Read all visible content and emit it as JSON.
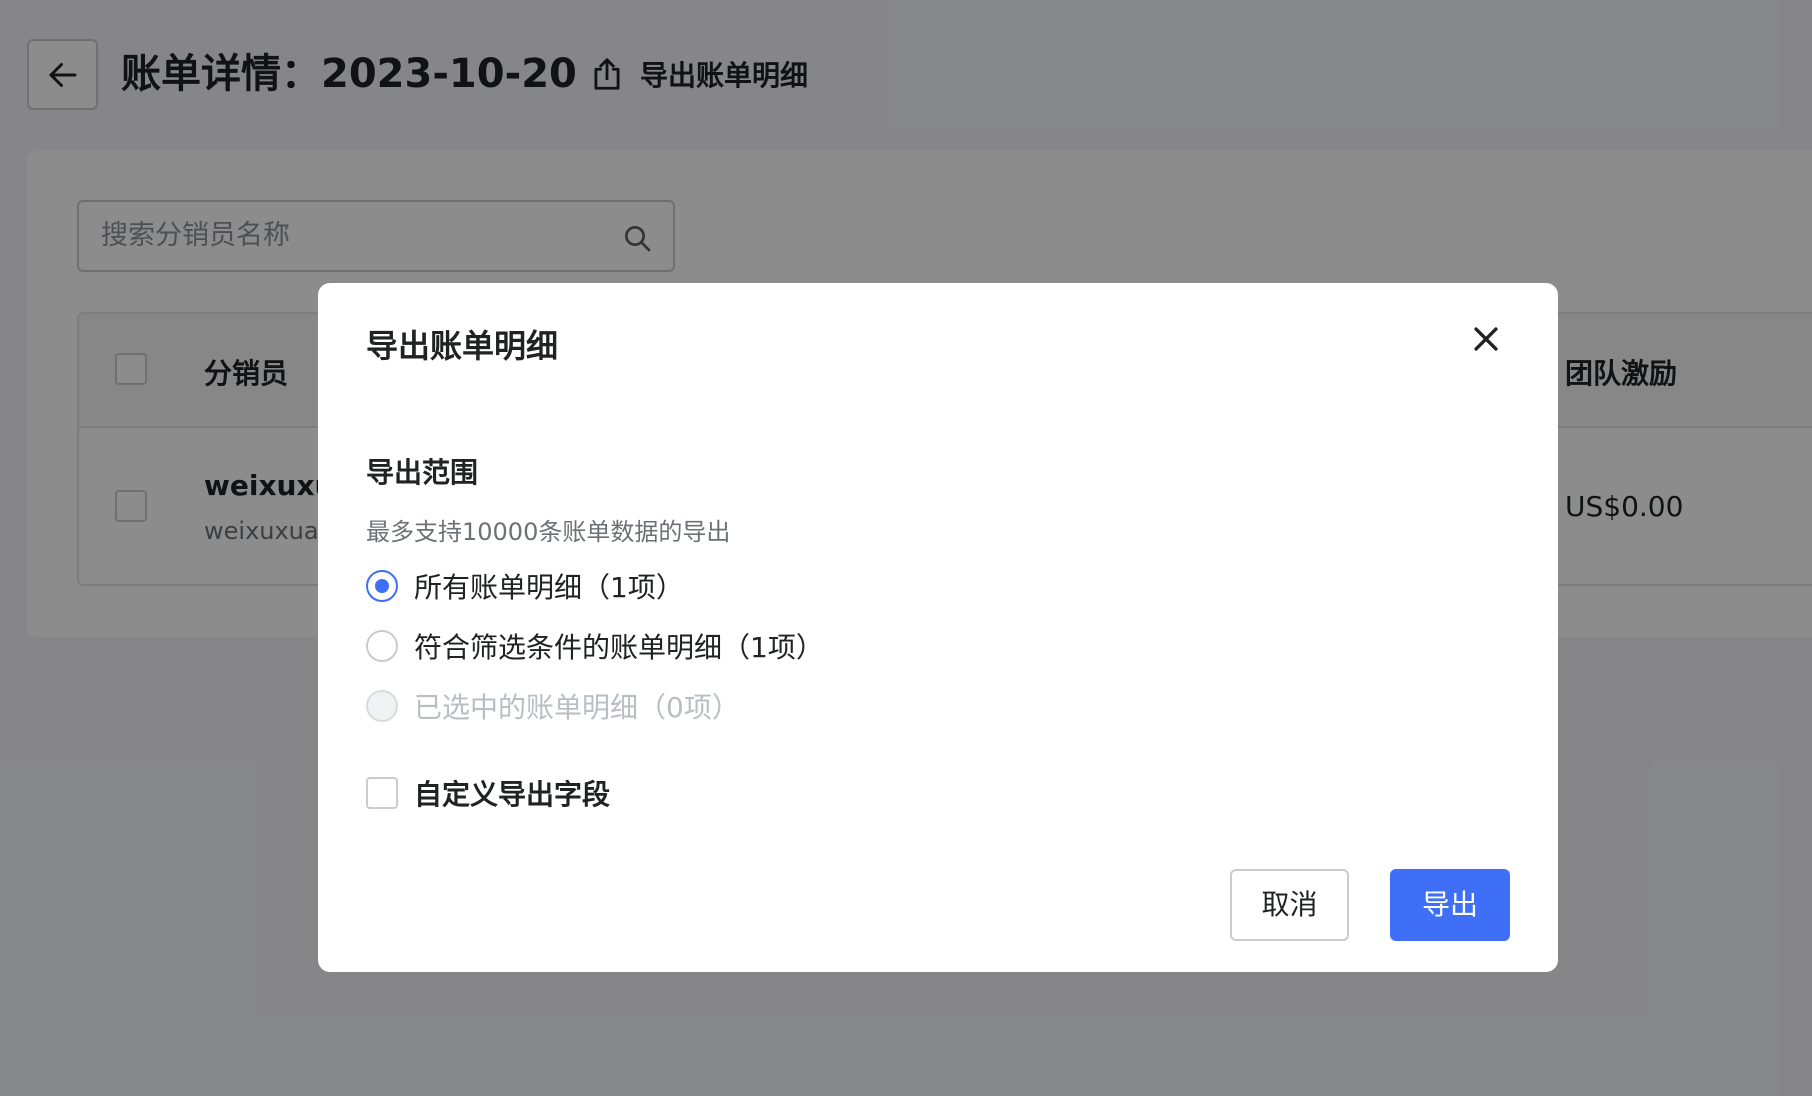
{
  "header": {
    "title": "账单详情：2023-10-20",
    "export_link_label": "导出账单明细"
  },
  "search": {
    "placeholder": "搜索分销员名称"
  },
  "table": {
    "columns": [
      "分销员",
      "团队激励"
    ],
    "rows": [
      {
        "name": "weixuxua",
        "sub": "weixuxuan",
        "team_incentive": "US$0.00"
      }
    ]
  },
  "modal": {
    "title": "导出账单明细",
    "section_title": "导出范围",
    "section_hint": "最多支持10000条账单数据的导出",
    "options": [
      {
        "label": "所有账单明细（1项）",
        "checked": true,
        "disabled": false
      },
      {
        "label": "符合筛选条件的账单明细（1项）",
        "checked": false,
        "disabled": false
      },
      {
        "label": "已选中的账单明细（0项）",
        "checked": false,
        "disabled": true
      }
    ],
    "custom_fields_label": "自定义导出字段",
    "cancel_label": "取消",
    "export_label": "导出"
  },
  "colors": {
    "primary": "#3e6ff6",
    "overlay": "rgba(0,0,0,0.45)"
  }
}
